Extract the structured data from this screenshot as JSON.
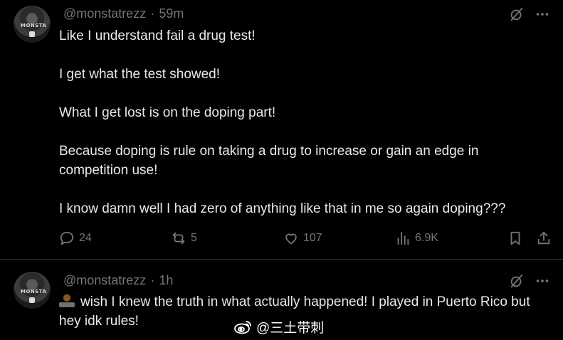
{
  "tweets": [
    {
      "handle": "@monstatrezz",
      "time": "59m",
      "avatar_text": "MONSTA",
      "paragraphs": [
        "Like I understand fail a drug test!",
        "I get what the test showed!",
        "What I get lost is on the doping part!",
        "Because doping is rule on taking a drug to increase or gain an edge in competition use!",
        "I know damn well I had zero of anything like that in me so again doping???"
      ],
      "stats": {
        "replies": "24",
        "reposts": "5",
        "likes": "107",
        "views": "6.9K"
      }
    },
    {
      "handle": "@monstatrezz",
      "time": "1h",
      "avatar_text": "MONSTA",
      "emoji": "person-with-laptop-emoji",
      "text": "wish I knew the truth in what actually happened! I played in Puerto Rico but hey idk rules!"
    }
  ],
  "watermark": {
    "text": "@三土带刺",
    "icon": "weibo-icon"
  },
  "icons": {
    "grok": "grok-icon",
    "more": "more-icon",
    "reply": "reply-icon",
    "repost": "repost-icon",
    "like": "heart-icon",
    "views": "views-icon",
    "bookmark": "bookmark-icon",
    "share": "share-icon"
  },
  "colors": {
    "background": "#000000",
    "text": "#e7e9ea",
    "secondary": "#71767b",
    "divider": "#2f3336"
  }
}
